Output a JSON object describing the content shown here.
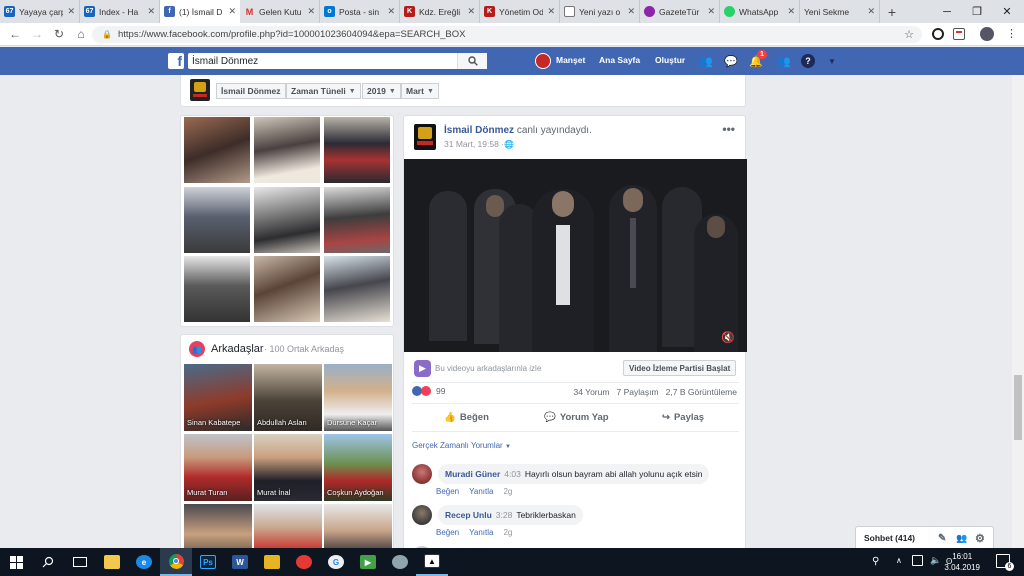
{
  "browser": {
    "tabs": [
      {
        "label": "Yayaya çarp",
        "fav": "67",
        "fav_color": "#1565c0"
      },
      {
        "label": "Index - Ha",
        "fav": "67",
        "fav_color": "#1565c0"
      },
      {
        "label": "(1) İsmail D",
        "fav": "f",
        "fav_color": "#4267b2"
      },
      {
        "label": "Gelen Kutu",
        "fav": "M",
        "fav_color": "#ffffff"
      },
      {
        "label": "Posta - sin",
        "fav": "o",
        "fav_color": "#0078d4"
      },
      {
        "label": "Kdz. Ereğli",
        "fav": "K",
        "fav_color": "#b71c1c"
      },
      {
        "label": "Yönetim Od",
        "fav": "K",
        "fav_color": "#b71c1c"
      },
      {
        "label": "Yeni yazı o",
        "fav": "",
        "fav_color": "#ffffff"
      },
      {
        "label": "GazeteTür",
        "fav": "",
        "fav_color": "#8e24aa"
      },
      {
        "label": "WhatsApp",
        "fav": "",
        "fav_color": "#25d366"
      },
      {
        "label": "Yeni Sekme",
        "fav": "",
        "fav_color": "#ffffff"
      }
    ],
    "url": "https://www.facebook.com/profile.php?id=100001023604094&epa=SEARCH_BOX"
  },
  "fb": {
    "search_value": "İsmail Dönmez",
    "nav": {
      "manset": "Manşet",
      "home": "Ana Sayfa",
      "create": "Oluştur",
      "notif_count": "1"
    },
    "crumbs": {
      "name": "İsmail Dönmez",
      "timeline": "Zaman Tüneli",
      "year": "2019",
      "month": "Mart"
    },
    "friends": {
      "title": "Arkadaşlar",
      "mutual": "· 100 Ortak Arkadaş",
      "list": [
        {
          "name": "Sinan Kabatepe"
        },
        {
          "name": "Abdullah Aslan"
        },
        {
          "name": "Dursune Kaçar"
        },
        {
          "name": "Murat Turan"
        },
        {
          "name": "Murat İnal"
        },
        {
          "name": "Coşkun Aydoğan"
        }
      ]
    },
    "post": {
      "author": "İsmail Dönmez",
      "action": "canlı yayındaydı.",
      "date": "31 Mart, 19:58 · ",
      "watch_text": "Bu videoyu arkadaşlarınla izle",
      "party_btn": "Video İzleme Partisi Başlat",
      "reactions": "99",
      "stats": "34 Yorum   7 Paylaşım   2,7 B Görüntüleme",
      "like": "Beğen",
      "comment": "Yorum Yap",
      "share": "Paylaş",
      "realtime": "Gerçek Zamanlı Yorumlar"
    },
    "comments": [
      {
        "name": "Muradi Güner",
        "time": "4:03",
        "text": "Hayırlı olsun bayram abi allah yolunu açık etsin",
        "like": "Beğen",
        "reply": "Yanıtla",
        "ago": "2g"
      },
      {
        "name": "Recep Unlu",
        "time": "3:28",
        "text": "Tebriklerbaskan",
        "like": "Beğen",
        "reply": "Yanıtla",
        "ago": "2g"
      }
    ],
    "chat": "Sohbet (414)"
  },
  "taskbar": {
    "time": "16:01",
    "date": "3.04.2019",
    "notif": "6"
  }
}
